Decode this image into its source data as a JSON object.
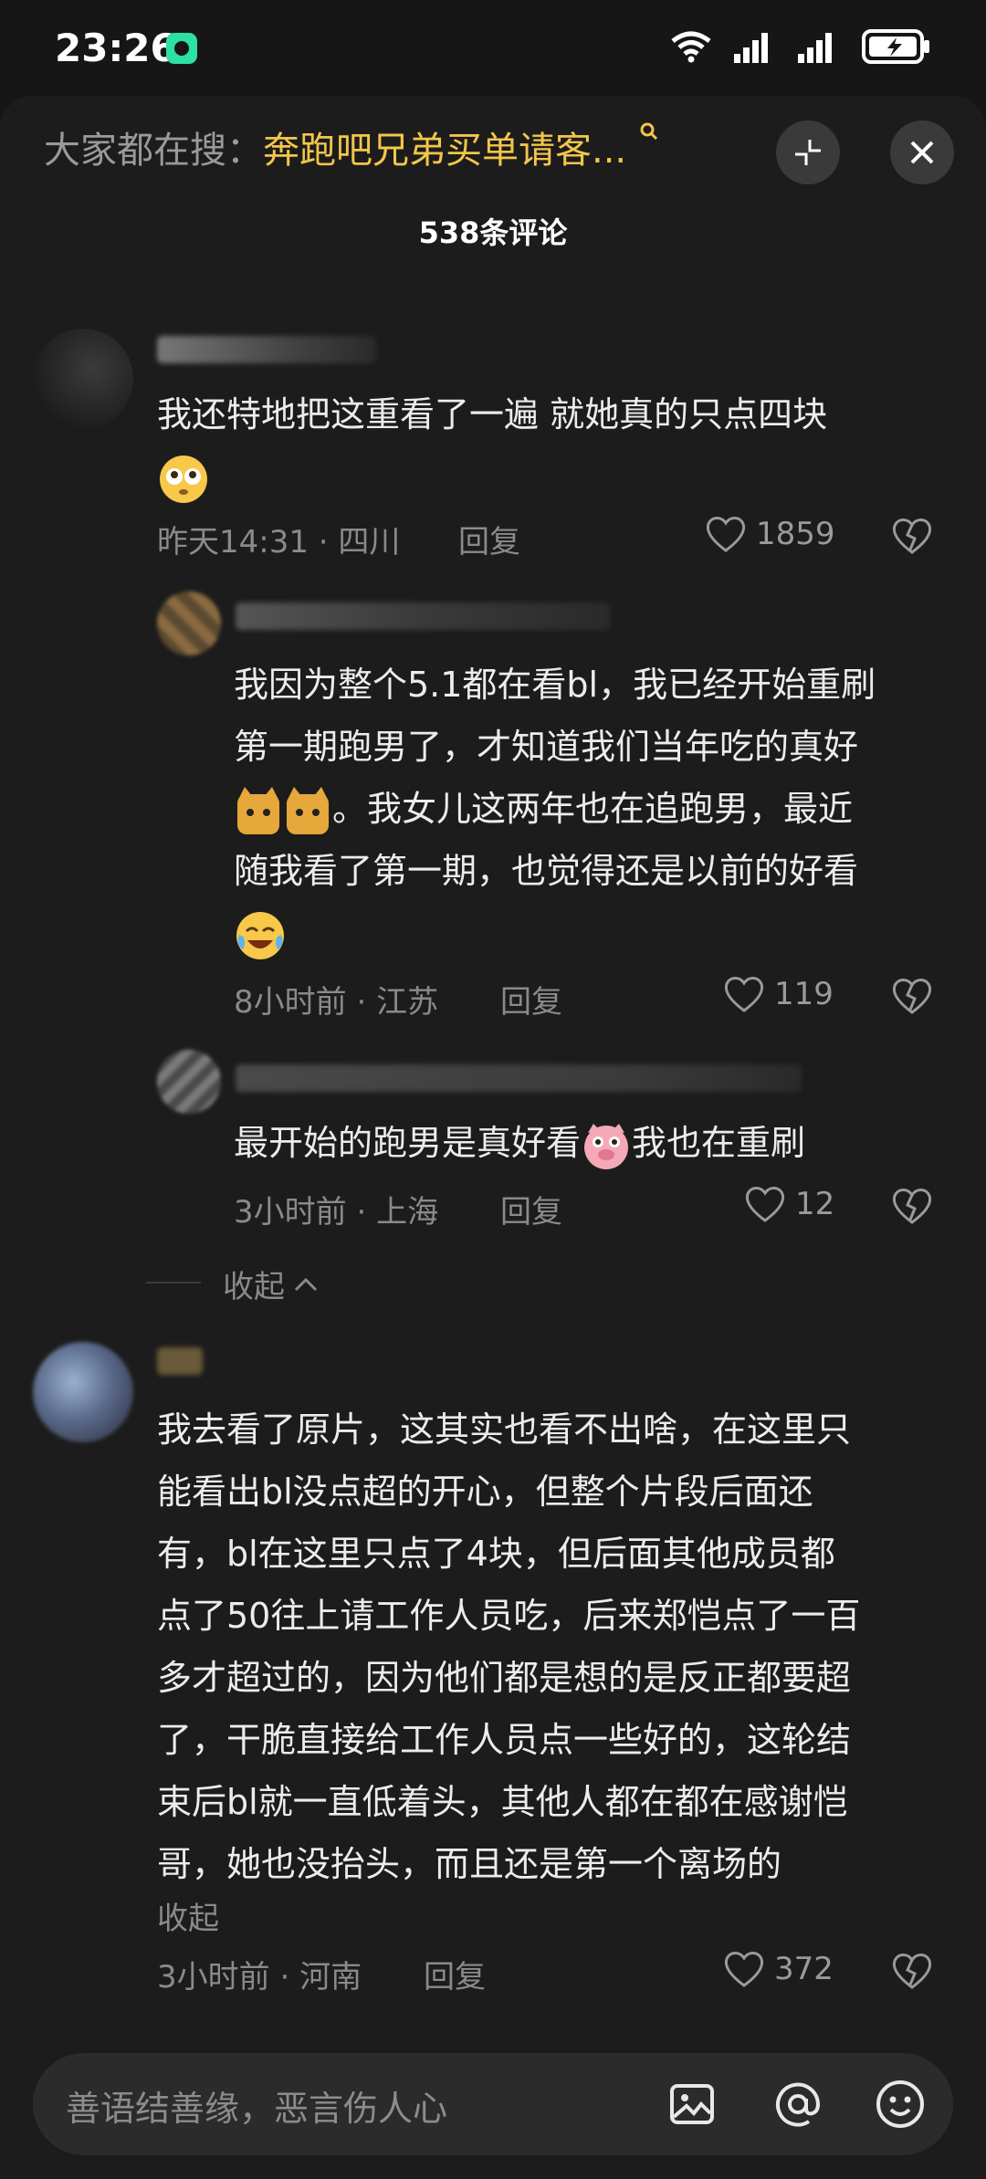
{
  "status_bar": {
    "time": "23:26"
  },
  "search": {
    "prefix": "大家都在搜：",
    "term": "奔跑吧兄弟买单请客..."
  },
  "header": {
    "title": "538条评论"
  },
  "comments": [
    {
      "text": "我还特地把这重看了一遍 就她真的只点四块",
      "time": "昨天14:31",
      "location": "四川",
      "reply": "回复",
      "likes": "1859"
    },
    {
      "text_lines": [
        "我因为整个5.1都在看bl，我已经开始重刷",
        "第一期跑男了，才知道我们当年吃的真好",
        "。我女儿这两年也在追跑男，最近",
        "随我看了第一期，也觉得还是以前的好看"
      ],
      "time": "8小时前",
      "location": "江苏",
      "reply": "回复",
      "likes": "119"
    },
    {
      "text_a": "最开始的跑男是真好看",
      "text_b": "我也在重刷",
      "time": "3小时前",
      "location": "上海",
      "reply": "回复",
      "likes": "12"
    },
    {
      "text_lines": [
        "我去看了原片，这其实也看不出啥，在这里只",
        "能看出bl没点超的开心，但整个片段后面还",
        "有，bl在这里只点了4块，但后面其他成员都",
        "点了50往上请工作人员吃，后来郑恺点了一百",
        "多才超过的，因为他们都是想的是反正都要超",
        "了，干脆直接给工作人员点一些好的，这轮结",
        "束后bl就一直低着头，其他人都在都在感谢恺",
        "哥，她也没抬头，而且还是第一个离场的"
      ],
      "collapse": "收起",
      "time": "3小时前",
      "location": "河南",
      "reply": "回复",
      "likes": "372"
    }
  ],
  "thread_collapse": "收起",
  "input": {
    "placeholder": "善语结善缘，恶言伤人心"
  },
  "icons": [
    "wifi-icon",
    "signal-icon",
    "battery-icon",
    "search-icon",
    "minimize-icon",
    "close-icon",
    "heart-icon",
    "broken-heart-icon",
    "chevron-up-icon",
    "image-icon",
    "at-icon",
    "emoji-icon"
  ]
}
